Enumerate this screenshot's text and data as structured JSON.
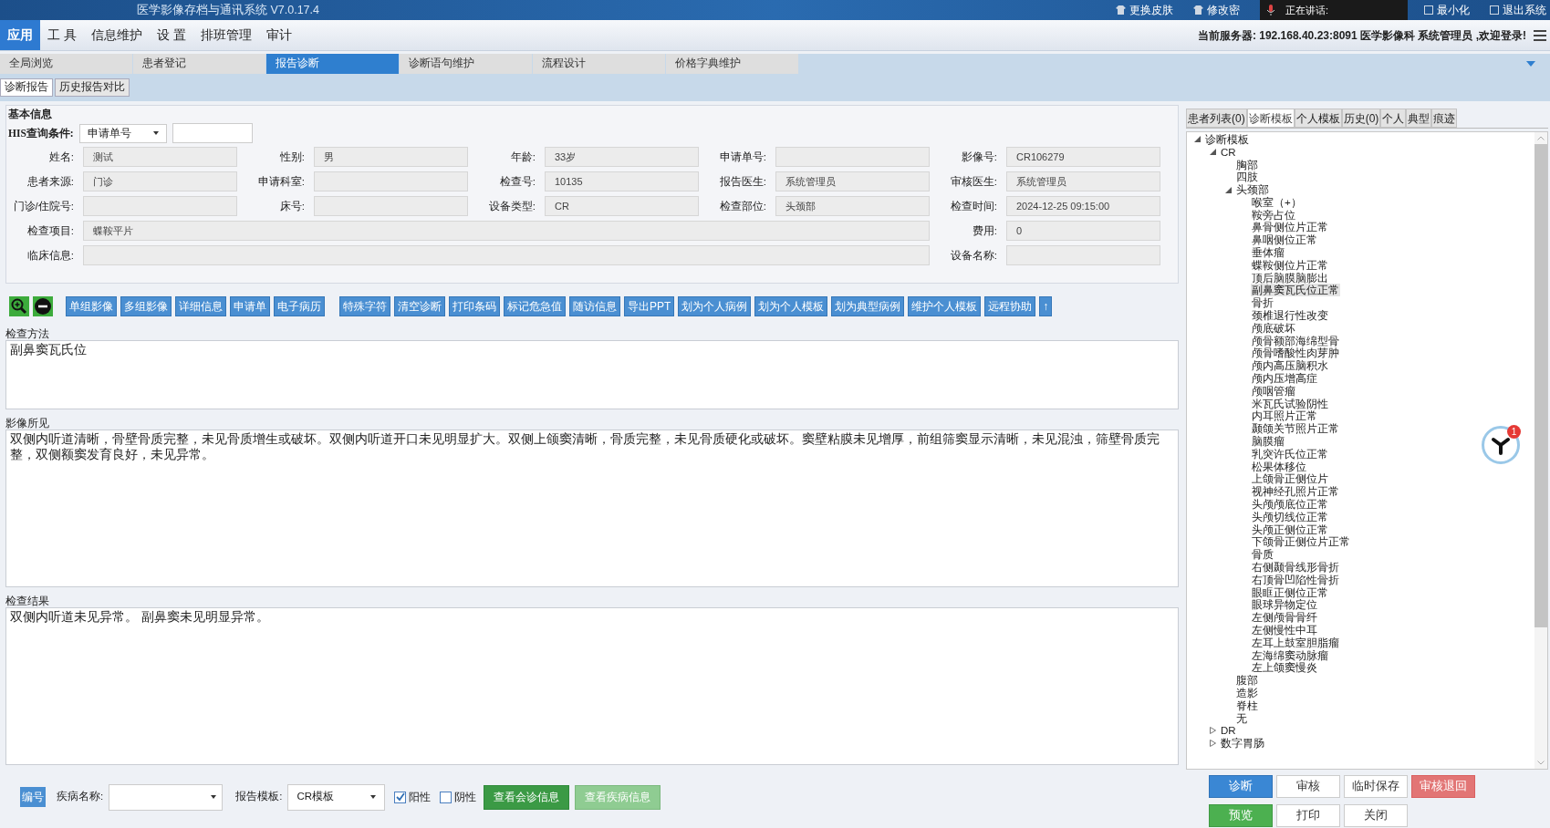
{
  "title_bar": {
    "title": "医学影像存档与通讯系统 V7.0.17.4",
    "actions": [
      "更换皮肤",
      "修改密"
    ],
    "speaking": "正在讲话:",
    "window_actions": [
      "最小化",
      "退出系统"
    ]
  },
  "menu": [
    {
      "label": "应用",
      "selected": true
    },
    {
      "label": "工 具",
      "selected": false
    },
    {
      "label": "信息维护",
      "selected": false
    },
    {
      "label": "设 置",
      "selected": false
    },
    {
      "label": "排班管理",
      "selected": false
    },
    {
      "label": "审计",
      "selected": false
    }
  ],
  "server_info": "当前服务器: 192.168.40.23:8091 医学影像科 系统管理员 ,欢迎登录!",
  "tabs": [
    {
      "label": "全局浏览",
      "selected": false
    },
    {
      "label": "患者登记",
      "selected": false
    },
    {
      "label": "报告诊断",
      "selected": true
    },
    {
      "label": "诊断语句维护",
      "selected": false
    },
    {
      "label": "流程设计",
      "selected": false
    },
    {
      "label": "价格字典维护",
      "selected": false
    }
  ],
  "sub_tabs": [
    {
      "label": "诊断报告",
      "selected": true
    },
    {
      "label": "历史报告对比",
      "selected": false
    }
  ],
  "basic_info": {
    "title": "基本信息",
    "his_label": "HIS查询条件:",
    "his_select": "申请单号",
    "rows": [
      [
        {
          "label": "姓名:",
          "value": "测试",
          "kind": "short"
        },
        {
          "label": "性别:",
          "value": "男",
          "kind": "short"
        },
        {
          "label": "年龄:",
          "value": "33岁",
          "kind": "short"
        },
        {
          "label": "申请单号:",
          "kind": "short"
        },
        {
          "label": "影像号:",
          "value": "CR106279",
          "kind": "short"
        }
      ],
      [
        {
          "label": "患者来源:",
          "value": "门诊",
          "kind": "short"
        },
        {
          "label": "申请科室:",
          "kind": "short"
        },
        {
          "label": "检查号:",
          "value": "10135",
          "kind": "short"
        },
        {
          "label": "报告医生:",
          "value": "系统管理员",
          "kind": "short"
        },
        {
          "label": "审核医生:",
          "value": "系统管理员",
          "kind": "short"
        }
      ],
      [
        {
          "label": "门诊/住院号:",
          "kind": "short"
        },
        {
          "label": "床号:",
          "kind": "short"
        },
        {
          "label": "设备类型:",
          "value": "CR",
          "kind": "short"
        },
        {
          "label": "检查部位:",
          "value": "头颈部",
          "kind": "short"
        },
        {
          "label": "检查时间:",
          "value": "2024-12-25 09:15:00",
          "kind": "short"
        }
      ],
      [
        {
          "label": "检查项目:",
          "value": "蝶鞍平片",
          "kind": "long"
        },
        {
          "label": "费用:",
          "value": "0",
          "kind": "short"
        }
      ],
      [
        {
          "label": "临床信息:",
          "kind": "long"
        },
        {
          "label": "设备名称:",
          "kind": "short"
        }
      ]
    ]
  },
  "toolbar": [
    [
      "单组影像",
      "多组影像",
      "详细信息",
      "申请单",
      "电子病历"
    ],
    [
      "特殊字符",
      "清空诊断",
      "打印条码",
      "标记危急值",
      "随访信息",
      "导出PPT",
      "划为个人病例",
      "划为个人模板",
      "划为典型病例",
      "维护个人模板",
      "远程协助",
      "↑"
    ]
  ],
  "sections": [
    {
      "title": "检查方法",
      "text": "副鼻窦瓦氏位"
    },
    {
      "title": "影像所见",
      "text": "双侧内听道清晰，骨壁骨质完整，未见骨质增生或破坏。双侧内听道开口未见明显扩大。双侧上颌窦清晰，骨质完整，未见骨质硬化或破坏。窦壁粘膜未见增厚，前组筛窦显示清晰，未见混浊，筛壁骨质完整，双侧额窦发育良好，未见异常。"
    },
    {
      "title": "检查结果",
      "text": "双侧内听道未见异常。     副鼻窦未见明显异常。"
    }
  ],
  "bottom_bar": {
    "code_button": "编号",
    "disease_label": "疾病名称:",
    "template_label": "报告模板:",
    "template_value": "CR模板",
    "checks": [
      {
        "label": "阳性",
        "checked": true
      },
      {
        "label": "阴性",
        "checked": false
      }
    ],
    "buttons": [
      {
        "label": "查看会诊信息",
        "disabled": false
      },
      {
        "label": "查看疾病信息",
        "disabled": true
      }
    ]
  },
  "side_tabs": [
    {
      "label": "患者列表(0)",
      "selected": false
    },
    {
      "label": "诊断模板",
      "selected": true
    },
    {
      "label": "个人模板",
      "selected": false
    },
    {
      "label": "历史(0)",
      "selected": false
    },
    {
      "label": "个人",
      "selected": false
    },
    {
      "label": "典型",
      "selected": false
    },
    {
      "label": "痕迹",
      "selected": false
    }
  ],
  "tree": [
    {
      "label": "诊断模板",
      "expanded": true,
      "selected": false,
      "children": [
        {
          "label": "CR",
          "expanded": true,
          "selected": false,
          "children": [
            {
              "label": "胸部",
              "selected": false
            },
            {
              "label": "四肢",
              "selected": false
            },
            {
              "label": "头颈部",
              "expanded": true,
              "selected": false,
              "children": [
                {
                  "label": "喉室（+）",
                  "selected": false
                },
                {
                  "label": "鞍旁占位",
                  "selected": false
                },
                {
                  "label": "鼻骨侧位片正常",
                  "selected": false
                },
                {
                  "label": "鼻咽侧位正常",
                  "selected": false
                },
                {
                  "label": "垂体瘤",
                  "selected": false
                },
                {
                  "label": "蝶鞍侧位片正常",
                  "selected": false
                },
                {
                  "label": "顶后脑膜脑膨出",
                  "selected": false
                },
                {
                  "label": "副鼻窦瓦氏位正常",
                  "selected": true
                },
                {
                  "label": "骨折",
                  "selected": false
                },
                {
                  "label": "颈椎退行性改变",
                  "selected": false
                },
                {
                  "label": "颅底破坏",
                  "selected": false
                },
                {
                  "label": "颅骨额部海绵型骨",
                  "selected": false
                },
                {
                  "label": "颅骨嗜酸性肉芽肿",
                  "selected": false
                },
                {
                  "label": "颅内高压脑积水",
                  "selected": false
                },
                {
                  "label": "颅内压增高症",
                  "selected": false
                },
                {
                  "label": "颅咽管瘤",
                  "selected": false
                },
                {
                  "label": "米瓦氏试验阴性",
                  "selected": false
                },
                {
                  "label": "内耳照片正常",
                  "selected": false
                },
                {
                  "label": "颞颌关节照片正常",
                  "selected": false
                },
                {
                  "label": "脑膜瘤",
                  "selected": false
                },
                {
                  "label": "乳突许氏位正常",
                  "selected": false
                },
                {
                  "label": "松果体移位",
                  "selected": false
                },
                {
                  "label": "上颌骨正侧位片",
                  "selected": false
                },
                {
                  "label": "视神经孔照片正常",
                  "selected": false
                },
                {
                  "label": "头颅颅底位正常",
                  "selected": false
                },
                {
                  "label": "头颅切线位正常",
                  "selected": false
                },
                {
                  "label": "头颅正侧位正常",
                  "selected": false
                },
                {
                  "label": "下颌骨正侧位片正常",
                  "selected": false
                },
                {
                  "label": "骨质",
                  "selected": false
                },
                {
                  "label": "右侧颞骨线形骨折",
                  "selected": false
                },
                {
                  "label": "右顶骨凹陷性骨折",
                  "selected": false
                },
                {
                  "label": "眼眶正侧位正常",
                  "selected": false
                },
                {
                  "label": "眼球异物定位",
                  "selected": false
                },
                {
                  "label": "左侧颅骨骨纤",
                  "selected": false
                },
                {
                  "label": "左侧慢性中耳",
                  "selected": false
                },
                {
                  "label": "左耳上鼓室胆脂瘤",
                  "selected": false
                },
                {
                  "label": "左海绵窦动脉瘤",
                  "selected": false
                },
                {
                  "label": "左上颌窦慢炎",
                  "selected": false
                }
              ]
            },
            {
              "label": "腹部",
              "selected": false
            },
            {
              "label": "造影",
              "selected": false
            },
            {
              "label": "脊柱",
              "selected": false
            },
            {
              "label": "无",
              "selected": false
            }
          ]
        },
        {
          "label": "DR",
          "expanded": false,
          "selected": false
        },
        {
          "label": "数字胃肠",
          "expanded": false,
          "selected": false
        }
      ]
    }
  ],
  "side_buttons": [
    {
      "label": "诊断",
      "kind": "primary"
    },
    {
      "label": "审核",
      "kind": "default"
    },
    {
      "label": "临时保存",
      "kind": "default"
    },
    {
      "label": "审核退回",
      "kind": "danger"
    },
    {
      "label": "预览",
      "kind": "success"
    },
    {
      "label": "打印",
      "kind": "default"
    },
    {
      "label": "关闭",
      "kind": "default"
    }
  ],
  "assistant": {
    "badge": "1"
  }
}
